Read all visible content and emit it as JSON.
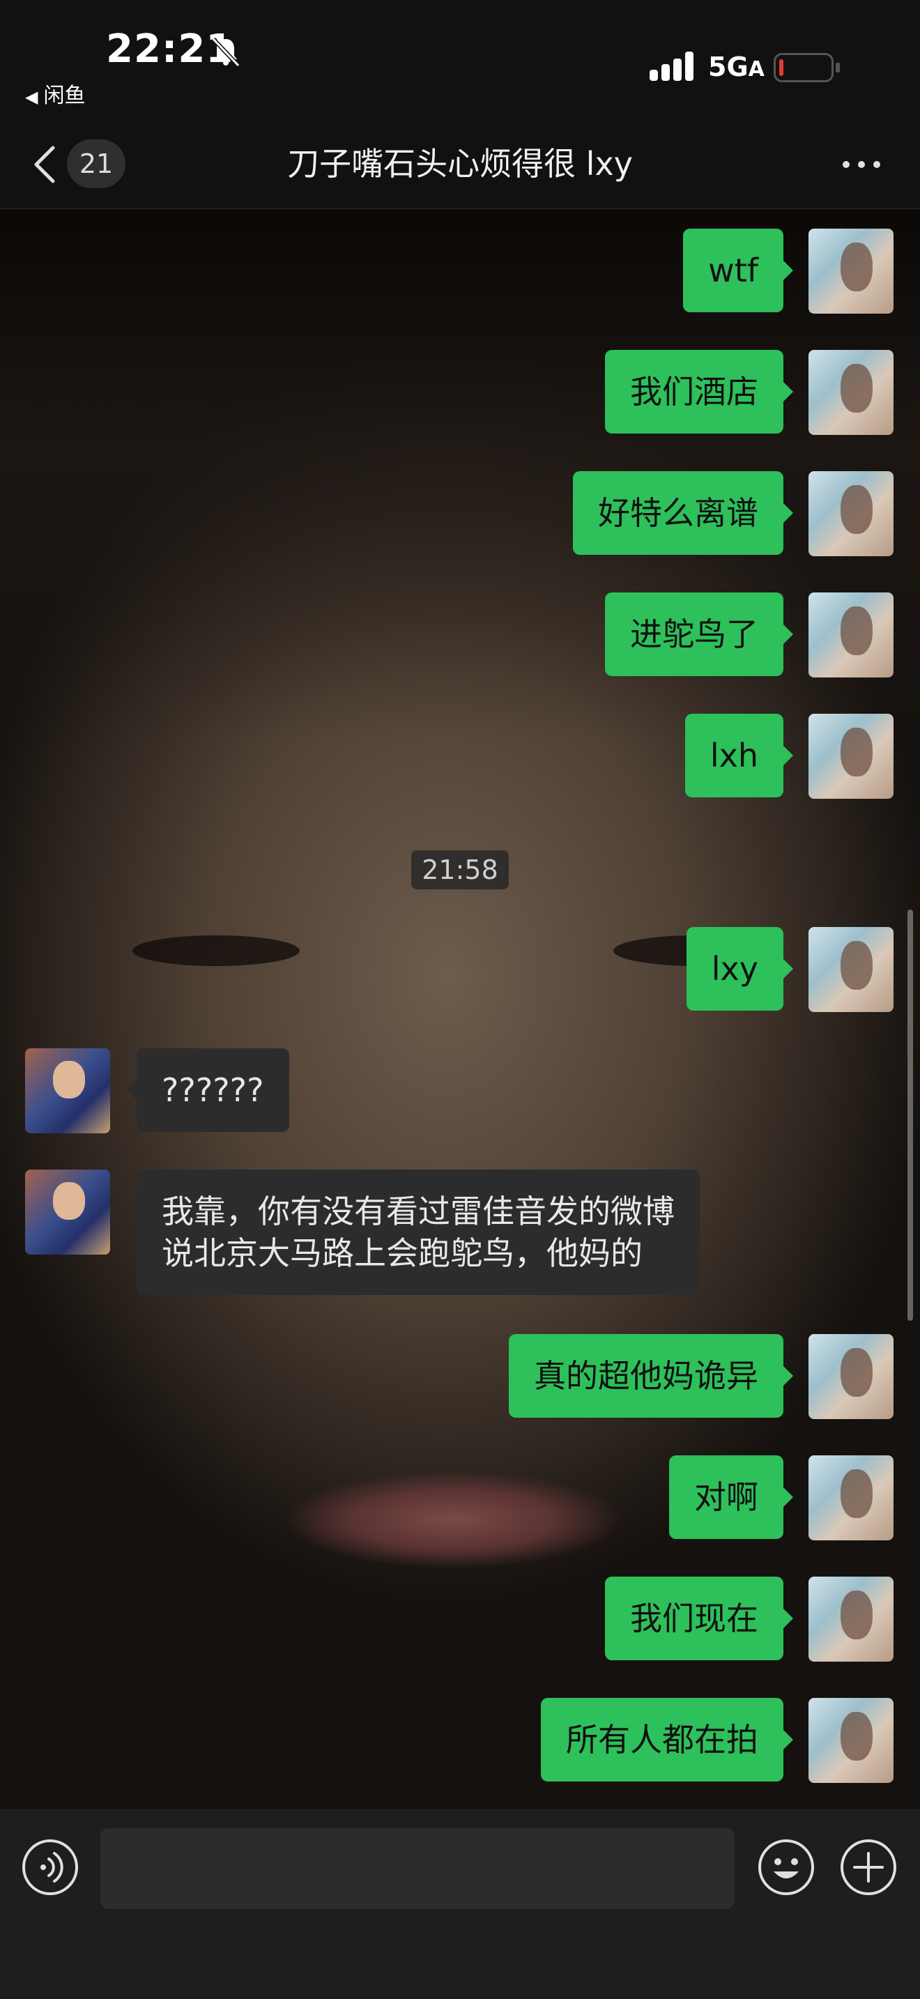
{
  "status_bar": {
    "time": "22:21",
    "back_app_label": "闲鱼",
    "network_label": "5G",
    "network_suffix": "A"
  },
  "nav": {
    "unread_count": "21",
    "title": "刀子嘴石头心烦得很 lxy"
  },
  "messages": [
    {
      "side": "out",
      "text": "wtf"
    },
    {
      "side": "out",
      "text": "我们酒店"
    },
    {
      "side": "out",
      "text": "好特么离谱"
    },
    {
      "side": "out",
      "text": "进鸵鸟了"
    },
    {
      "side": "out",
      "text": "lxh"
    },
    {
      "side": "out",
      "text": "lxy"
    },
    {
      "side": "in",
      "text": "??????"
    },
    {
      "side": "in",
      "text": "我靠，你有没有看过雷佳音发的微博",
      "text_line2": "说北京大马路上会跑鸵鸟，他妈的"
    },
    {
      "side": "out",
      "text": "真的超他妈诡异"
    },
    {
      "side": "out",
      "text": "对啊"
    },
    {
      "side": "out",
      "text": "我们现在"
    },
    {
      "side": "out",
      "text": "所有人都在拍"
    }
  ],
  "timestamp": "21:58",
  "input": {
    "value": "",
    "placeholder": ""
  },
  "colors": {
    "outgoing_bubble": "#2ec05a",
    "incoming_bubble": "#2c2c2c",
    "bar_background": "#111111",
    "battery_low": "#e53935"
  }
}
